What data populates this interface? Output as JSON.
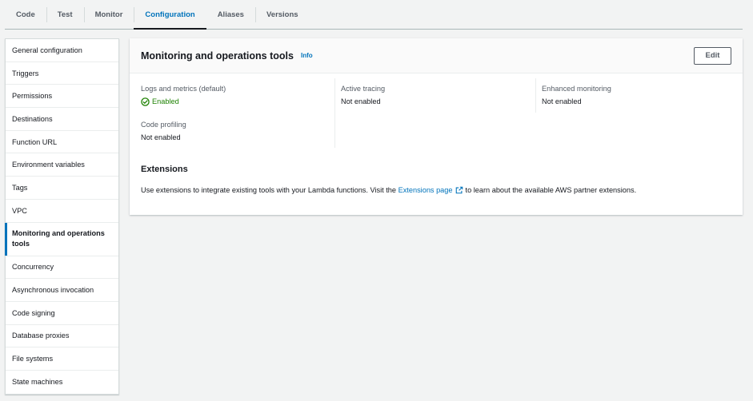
{
  "tabs": [
    "Code",
    "Test",
    "Monitor",
    "Configuration",
    "Aliases",
    "Versions"
  ],
  "active_tab": "Configuration",
  "sidebar": {
    "items": [
      {
        "label": "General configuration"
      },
      {
        "label": "Triggers"
      },
      {
        "label": "Permissions"
      },
      {
        "label": "Destinations"
      },
      {
        "label": "Function URL"
      },
      {
        "label": "Environment variables"
      },
      {
        "label": "Tags"
      },
      {
        "label": "VPC"
      },
      {
        "label": "Monitoring and operations tools",
        "active": true
      },
      {
        "label": "Concurrency"
      },
      {
        "label": "Asynchronous invocation"
      },
      {
        "label": "Code signing"
      },
      {
        "label": "Database proxies"
      },
      {
        "label": "File systems"
      },
      {
        "label": "State machines"
      }
    ]
  },
  "panel": {
    "title": "Monitoring and operations tools",
    "info_label": "Info",
    "edit_label": "Edit",
    "fields": {
      "logs": {
        "label": "Logs and metrics (default)",
        "value": "Enabled"
      },
      "tracing": {
        "label": "Active tracing",
        "value": "Not enabled"
      },
      "enhanced": {
        "label": "Enhanced monitoring",
        "value": "Not enabled"
      },
      "profiling": {
        "label": "Code profiling",
        "value": "Not enabled"
      }
    },
    "extensions": {
      "title": "Extensions",
      "text_before": "Use extensions to integrate existing tools with your Lambda functions. Visit the",
      "link_label": "Extensions page",
      "text_after": "to learn about the available AWS partner extensions."
    }
  },
  "colors": {
    "accent": "#0073bb",
    "success": "#1d8102",
    "background": "#f2f3f3"
  },
  "icons": {
    "status": "check-circle-icon",
    "external": "external-link-icon"
  }
}
